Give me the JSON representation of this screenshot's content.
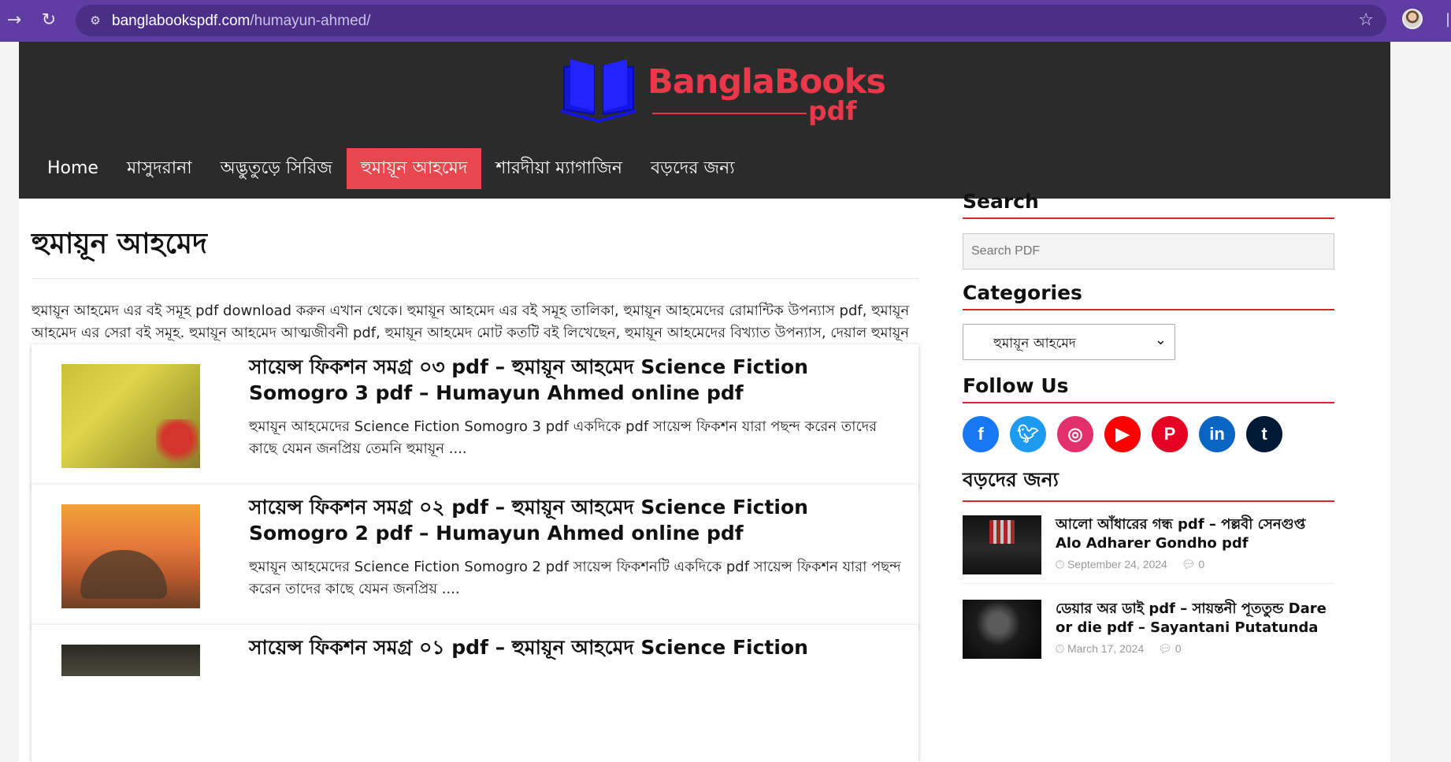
{
  "browser": {
    "back_icon": "arrow-right-icon",
    "reload_icon": "reload-icon",
    "url_domain": "banglabookspdf.com",
    "url_path": "/humayun-ahmed/"
  },
  "site": {
    "logo_text": "BanglaBooks",
    "logo_sub": "pdf",
    "nav": [
      {
        "label": "Home"
      },
      {
        "label": "মাসুদরানা"
      },
      {
        "label": "অদ্ভুতুড়ে সিরিজ"
      },
      {
        "label": "হুমায়ূন আহমেদ"
      },
      {
        "label": "শারদীয়া ম্যাগাজিন"
      },
      {
        "label": "বড়দের জন্য"
      }
    ],
    "active_nav_color": "#e8474f",
    "accent_color": "#d7262e"
  },
  "main": {
    "page_title": "হুমায়ূন আহমেদ",
    "description": "হুমায়ূন আহমেদ এর বই সমূহ pdf download করুন এখান থেকে। হুমায়ূন আহমেদ এর বই সমূহ তালিকা, হুমায়ূন আহমেদের রোমান্টিক উপন্যাস pdf, হুমায়ূন আহমেদ এর সেরা বই সমূহ. হুমায়ূন আহমেদ আত্মজীবনী pdf, হুমায়ূন আহমেদ মোট কতটি বই লিখেছেন, হুমায়ূন আহমেদের বিখ্যাত উপন্যাস, দেয়াল হুমায়ূন আহমেদ pdf download, হুমায়ূন আহমেদের শ্রেষ্ঠ গল্প, হুমায়ূন আহমেদ আত্মজীবনী pdf সব পাবেন এখানে।",
    "posts": [
      {
        "title": "সায়েন্স ফিকশন সমগ্র ০৩ pdf – হুমায়ূন আহমেদ Science Fiction Somogro 3 pdf – Humayun Ahmed online pdf",
        "excerpt": "হুমায়ূন আহমেদের Science Fiction Somogro 3 pdf একদিকে pdf সায়েন্স ফিকশন যারা পছন্দ করেন তাদের কাছে যেমন জনপ্রিয় তেমনি হুমায়ূন ...."
      },
      {
        "title": "সায়েন্স ফিকশন সমগ্র ০২ pdf – হুমায়ূন আহমেদ Science Fiction Somogro 2 pdf – Humayun Ahmed online pdf",
        "excerpt": "হুমায়ূন আহমেদের Science Fiction Somogro 2 pdf সায়েন্স ফিকশনটি একদিকে pdf সায়েন্স ফিকশন যারা পছন্দ করেন তাদের কাছে যেমন জনপ্রিয় ...."
      },
      {
        "title": "সায়েন্স ফিকশন সমগ্র ০১ pdf – হুমায়ূন আহমেদ Science Fiction"
      }
    ]
  },
  "sidebar": {
    "search_title": "Search",
    "search_placeholder": "Search PDF",
    "categories_title": "Categories",
    "category_selected": "হুমায়ূন আহমেদ",
    "follow_title": "Follow Us",
    "social": [
      {
        "icon": "facebook-icon",
        "glyph": "f",
        "color": "#1877f2"
      },
      {
        "icon": "twitter-icon",
        "glyph": "t",
        "color": "#1d9bf0"
      },
      {
        "icon": "instagram-icon",
        "glyph": "◎",
        "color": "#e1306c"
      },
      {
        "icon": "youtube-icon",
        "glyph": "▶",
        "color": "#ff0000"
      },
      {
        "icon": "pinterest-icon",
        "glyph": "P",
        "color": "#e60023"
      },
      {
        "icon": "linkedin-icon",
        "glyph": "in",
        "color": "#0a66c2"
      },
      {
        "icon": "tumblr-icon",
        "glyph": "t",
        "color": "#001935"
      }
    ],
    "adult_title": "বড়দের জন্য",
    "recent": [
      {
        "title": "আলো আঁধারের গন্ধ pdf – পল্লবী সেনগুপ্ত Alo Adharer Gondho pdf",
        "date": "September 24, 2024",
        "comments": "0"
      },
      {
        "title": "ডেয়ার অর ডাই pdf – সায়ন্তনী পূততুন্ড Dare or die pdf – Sayantani Putatunda",
        "date": "March 17, 2024",
        "comments": "0"
      }
    ]
  }
}
